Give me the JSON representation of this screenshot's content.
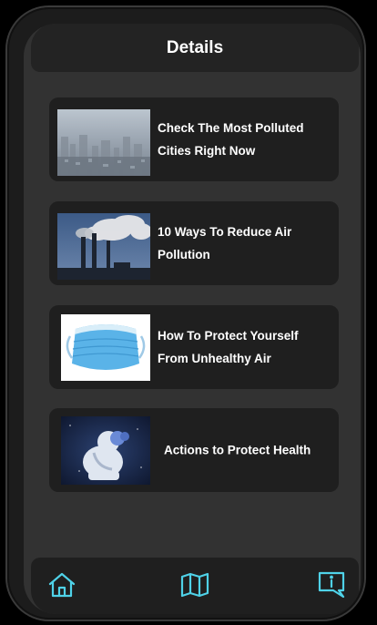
{
  "header": {
    "title": "Details"
  },
  "cards": [
    {
      "title": "Check The Most Polluted\nCities Right Now",
      "image": "polluted-city-image"
    },
    {
      "title": "10  Ways To Reduce Air\nPollution",
      "image": "factory-smoke-image"
    },
    {
      "title": "How To  Protect Yourself\nFrom Unhealthy Air",
      "image": "face-mask-image"
    },
    {
      "title": "Actions to Protect Health",
      "image": "protective-suit-person-image"
    }
  ],
  "navbar": {
    "items": [
      {
        "icon": "home-icon"
      },
      {
        "icon": "map-icon"
      },
      {
        "icon": "info-message-icon"
      }
    ],
    "accent_color": "#4fd2e8"
  }
}
